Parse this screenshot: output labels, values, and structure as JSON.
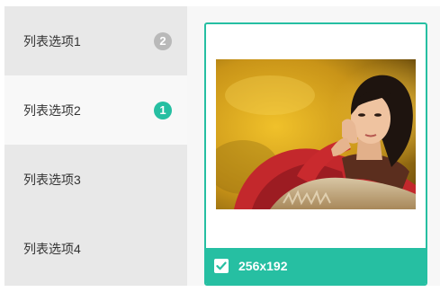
{
  "sidebar": {
    "items": [
      {
        "label": "列表选项1",
        "badge": "2",
        "badge_color": "#b9b9b9",
        "active": false
      },
      {
        "label": "列表选项2",
        "badge": "1",
        "badge_color": "#26bfa2",
        "active": true
      },
      {
        "label": "列表选项3",
        "active": false
      },
      {
        "label": "列表选项4",
        "active": false
      }
    ]
  },
  "card": {
    "image": "photo-woman-yellow-background",
    "size_label": "256x192",
    "checked": true,
    "checkbox_icon": "checkmark-icon",
    "accent_color": "#26bfa2"
  }
}
